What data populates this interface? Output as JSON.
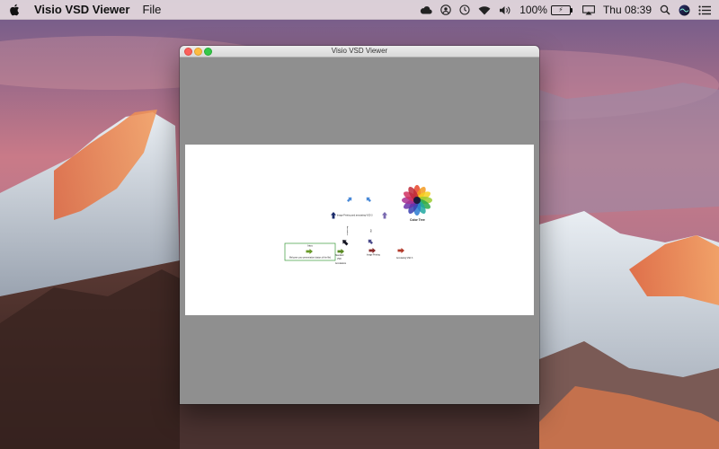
{
  "menubar": {
    "app_name": "Visio VSD Viewer",
    "menu_file": "File",
    "battery_percent": "100%",
    "clock": "Thu 08:39"
  },
  "window": {
    "title": "Visio VSD Viewer"
  },
  "drawing": {
    "labels": {
      "box_title": "Intro",
      "box_text": "Welcome your presentation (status of the file)",
      "color_tree": "Color Tree",
      "printing_top": "Image Printing and annotating VSD 3",
      "printing_bottom": "Image Printing",
      "annotating": "Annotating VSD 3",
      "standard_1": "Standard",
      "standard_2": "VSD",
      "standard_3": "Annotations"
    }
  },
  "colors": {
    "window_bg": "#8f8f8f",
    "canvas_bg": "#ffffff",
    "box_border": "#3a9a3a"
  }
}
